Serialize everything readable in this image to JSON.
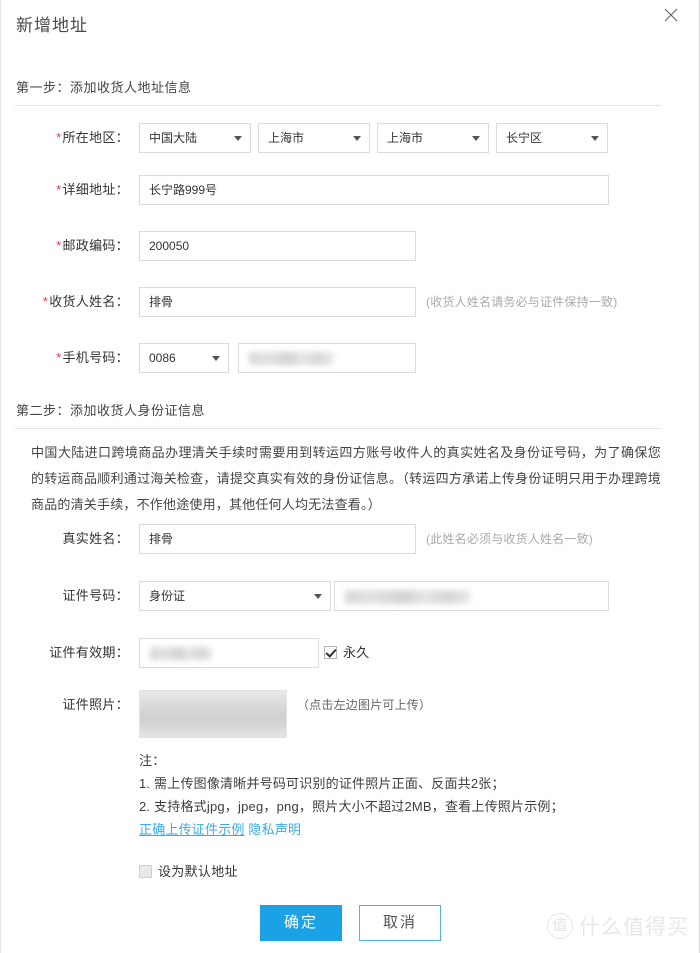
{
  "dialog": {
    "title": "新增地址",
    "close_icon": "close-icon"
  },
  "step1": {
    "heading": "第一步：添加收货人地址信息",
    "rows": {
      "region": {
        "label": "所在地区：",
        "required": "*",
        "selects": [
          {
            "value": "中国大陆"
          },
          {
            "value": "上海市"
          },
          {
            "value": "上海市"
          },
          {
            "value": "长宁区"
          }
        ]
      },
      "detail": {
        "label": "详细地址：",
        "required": "*",
        "value": "长宁路999号"
      },
      "postcode": {
        "label": "邮政编码：",
        "required": "*",
        "value": "200050"
      },
      "receiver": {
        "label": "收货人姓名：",
        "required": "*",
        "value": "排骨",
        "hint": "(收货人姓名请务必与证件保持一致)"
      },
      "phone": {
        "label": "手机号码：",
        "required": "*",
        "code": "0086",
        "value": ""
      }
    }
  },
  "step2": {
    "heading": "第二步：添加收货人身份证信息",
    "notice": "中国大陆进口跨境商品办理清关手续时需要用到转运四方账号收件人的真实姓名及身份证号码，为了确保您的转运商品顺利通过海关检查，请提交真实有效的身份证信息。（转运四方承诺上传身份证明只用于办理跨境商品的清关手续，不作他途使用，其他任何人均无法查看。）",
    "rows": {
      "realname": {
        "label": "真实姓名：",
        "value": "排骨",
        "hint": "(此姓名必须与收货人姓名一致)"
      },
      "idnumber": {
        "label": "证件号码：",
        "type_value": "身份证",
        "value": ""
      },
      "validity": {
        "label": "证件有效期：",
        "value": "",
        "permanent_label": "永久",
        "permanent_checked": true
      },
      "photo": {
        "label": "证件照片：",
        "hint": "（点击左边图片可上传）"
      }
    },
    "notes": {
      "title": "注：",
      "line1": "1. 需上传图像清晰并号码可识别的证件照片正面、反面共2张；",
      "line2": "2. 支持格式jpg，jpeg，png，照片大小不超过2MB，查看上传照片示例；",
      "link1": "正确上传证件示例",
      "link2": "隐私声明"
    }
  },
  "footer": {
    "default_address_label": "设为默认地址",
    "default_address_checked": false,
    "confirm_label": "确定",
    "cancel_label": "取消"
  },
  "watermark": {
    "mark": "值",
    "text": "什么值得买"
  },
  "colors": {
    "primary": "#1ba1e6",
    "link": "#3aabe8",
    "required": "#e4393c",
    "border": "#dcdcdc"
  }
}
